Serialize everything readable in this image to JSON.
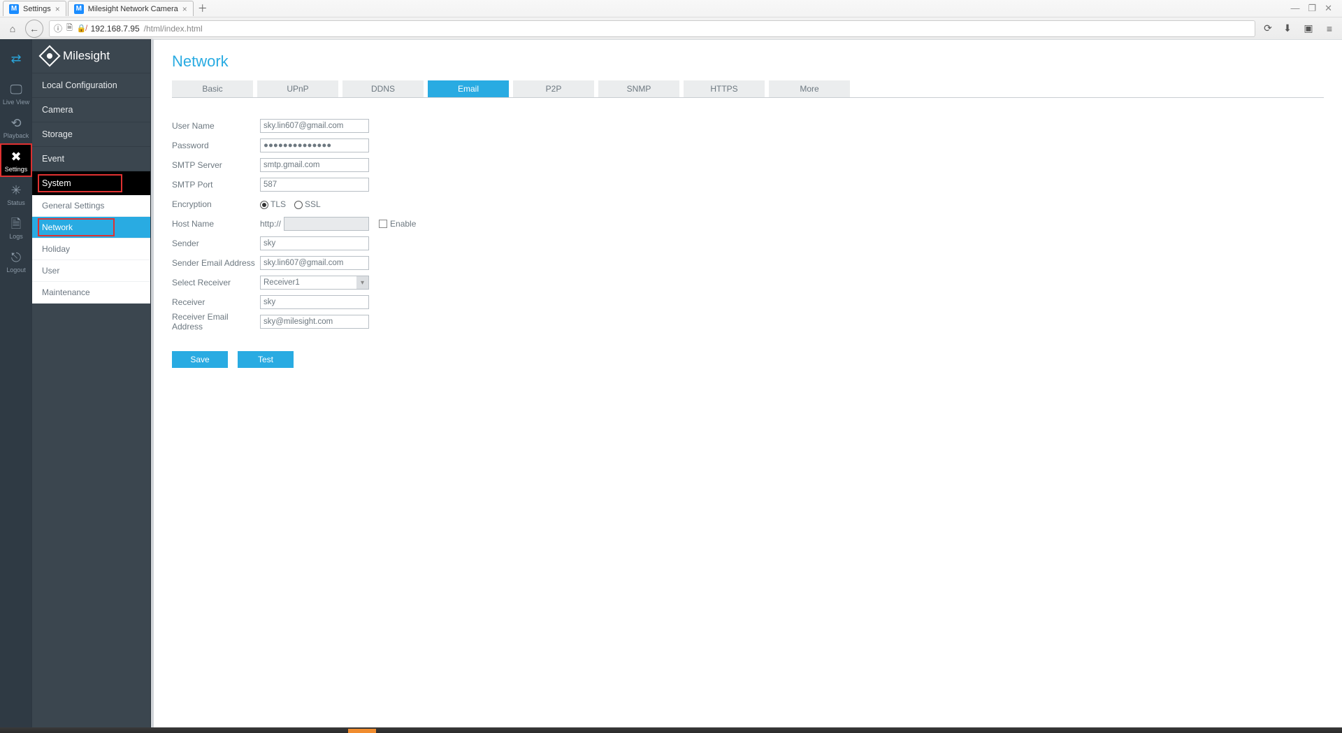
{
  "browser": {
    "tabs": [
      {
        "title": "Settings"
      },
      {
        "title": "Milesight Network Camera"
      }
    ],
    "url_host": "192.168.7.95",
    "url_path": "/html/index.html"
  },
  "brand": "Milesight",
  "rail": {
    "live_view": "Live View",
    "playback": "Playback",
    "settings": "Settings",
    "status": "Status",
    "logs": "Logs",
    "logout": "Logout"
  },
  "menu": {
    "local_configuration": "Local Configuration",
    "camera": "Camera",
    "storage": "Storage",
    "event": "Event",
    "system": "System",
    "sub": {
      "general_settings": "General Settings",
      "network": "Network",
      "holiday": "Holiday",
      "user": "User",
      "maintenance": "Maintenance"
    }
  },
  "page_title": "Network",
  "tabs": {
    "basic": "Basic",
    "upnp": "UPnP",
    "ddns": "DDNS",
    "email": "Email",
    "p2p": "P2P",
    "snmp": "SNMP",
    "https": "HTTPS",
    "more": "More"
  },
  "form": {
    "labels": {
      "user_name": "User Name",
      "password": "Password",
      "smtp_server": "SMTP Server",
      "smtp_port": "SMTP Port",
      "encryption": "Encryption",
      "tls": "TLS",
      "ssl": "SSL",
      "host_name": "Host Name",
      "host_prefix": "http://",
      "enable": "Enable",
      "sender": "Sender",
      "sender_email": "Sender Email Address",
      "select_receiver": "Select Receiver",
      "receiver": "Receiver",
      "receiver_email": "Receiver Email Address"
    },
    "values": {
      "user_name": "sky.lin607@gmail.com",
      "password": "●●●●●●●●●●●●●●",
      "smtp_server": "smtp.gmail.com",
      "smtp_port": "587",
      "host_name": "",
      "sender": "sky",
      "sender_email": "sky.lin607@gmail.com",
      "select_receiver": "Receiver1",
      "receiver": "sky",
      "receiver_email": "sky@milesight.com"
    }
  },
  "buttons": {
    "save": "Save",
    "test": "Test"
  }
}
